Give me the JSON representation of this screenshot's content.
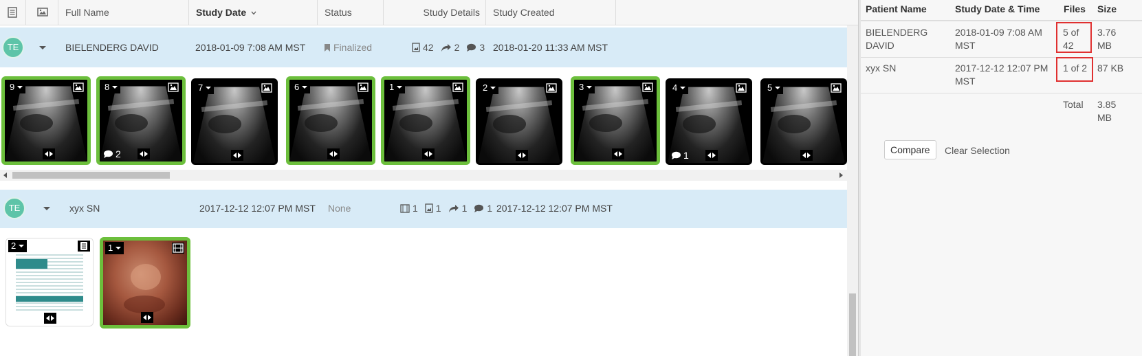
{
  "header": {
    "col_fullname": "Full Name",
    "col_studydate": "Study Date",
    "col_status": "Status",
    "col_details": "Study Details",
    "col_created": "Study Created"
  },
  "studies": [
    {
      "avatar": "TE",
      "name": "BIELENDERG DAVID",
      "date": "2018-01-09 7:08 AM MST",
      "status": "Finalized",
      "images_count": "42",
      "shares_count": "2",
      "comments_count": "3",
      "created": "2018-01-20 11:33 AM MST",
      "thumbnails": [
        {
          "num": "9",
          "selected": true,
          "comments": ""
        },
        {
          "num": "8",
          "selected": true,
          "comments": "2"
        },
        {
          "num": "7",
          "selected": false,
          "comments": ""
        },
        {
          "num": "6",
          "selected": true,
          "comments": ""
        },
        {
          "num": "1",
          "selected": true,
          "comments": ""
        },
        {
          "num": "2",
          "selected": false,
          "comments": ""
        },
        {
          "num": "3",
          "selected": true,
          "comments": ""
        },
        {
          "num": "4",
          "selected": false,
          "comments": "1"
        },
        {
          "num": "5",
          "selected": false,
          "comments": ""
        }
      ]
    },
    {
      "avatar": "TE",
      "name": "xyx SN",
      "date": "2017-12-12 12:07 PM MST",
      "status": "None",
      "videos_count": "1",
      "images_count": "1",
      "shares_count": "1",
      "comments_count": "1",
      "created": "2017-12-12 12:07 PM MST",
      "thumbnails": [
        {
          "num": "2",
          "selected": false,
          "kind": "document"
        },
        {
          "num": "1",
          "selected": true,
          "kind": "video"
        }
      ]
    }
  ],
  "compare_panel": {
    "col_patient": "Patient Name",
    "col_datetime": "Study Date & Time",
    "col_files": "Files",
    "col_size": "Size",
    "rows": [
      {
        "patient_line1": "BIELENDERG",
        "patient_line2": "DAVID",
        "date_line1": "2018-01-09 7:08 AM",
        "date_line2": "MST",
        "files_line1": "5 of",
        "files_line2": "42",
        "size_line1": "3.76",
        "size_line2": "MB"
      },
      {
        "patient_line1": "xyx SN",
        "patient_line2": "",
        "date_line1": "2017-12-12 12:07 PM",
        "date_line2": "MST",
        "files_line1": "1 of 2",
        "files_line2": "",
        "size_line1": "87 KB",
        "size_line2": ""
      }
    ],
    "total_label": "Total",
    "total_size_line1": "3.85",
    "total_size_line2": "MB",
    "compare_button": "Compare",
    "clear_link": "Clear Selection"
  },
  "colors": {
    "row_bg": "#d8ebf7",
    "selected_border": "#6cbf3c",
    "avatar_bg": "#5ec4a8",
    "highlight_box": "#e03030"
  }
}
